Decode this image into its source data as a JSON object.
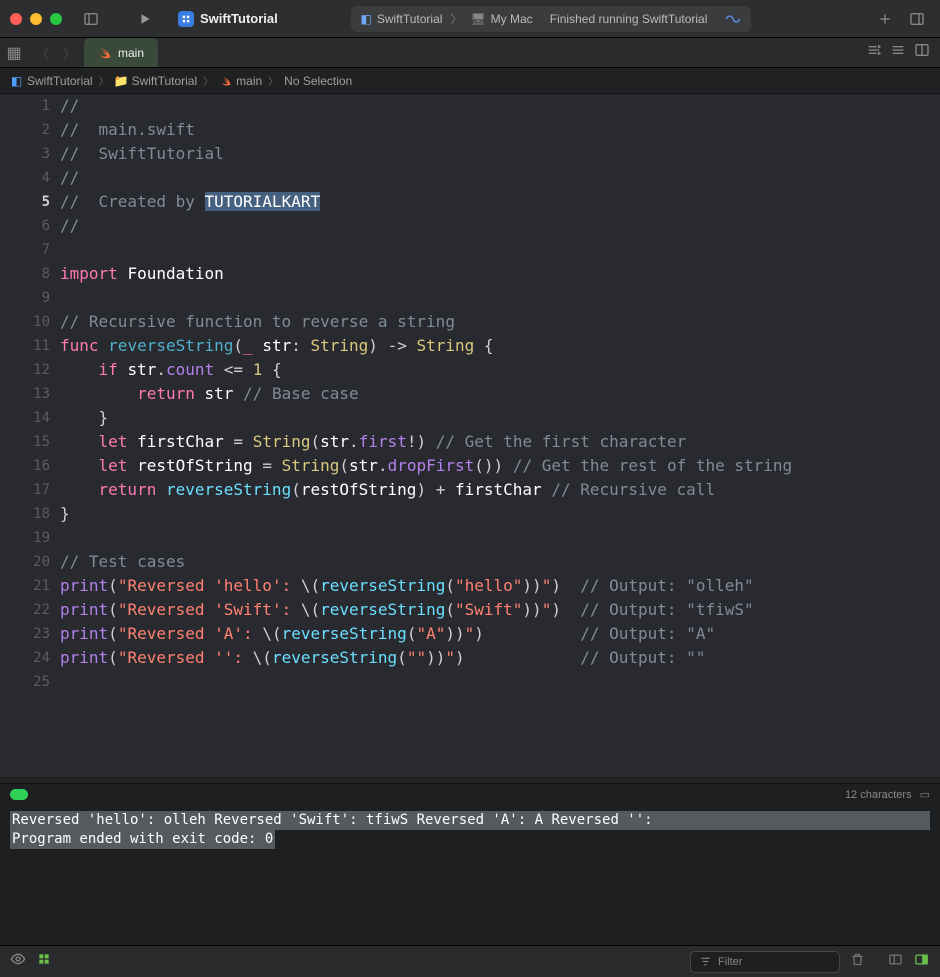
{
  "titlebar": {
    "project_name": "SwiftTutorial",
    "scheme": "SwiftTutorial",
    "destination": "My Mac",
    "status": "Finished running SwiftTutorial"
  },
  "tab": {
    "name": "main"
  },
  "breadcrumb": {
    "items": [
      "SwiftTutorial",
      "SwiftTutorial",
      "main",
      "No Selection"
    ]
  },
  "editor": {
    "current_line": 5,
    "selected_text": "TUTORIALKART",
    "lines": [
      {
        "n": 1,
        "t": "//"
      },
      {
        "n": 2,
        "t": "//  main.swift"
      },
      {
        "n": 3,
        "t": "//  SwiftTutorial"
      },
      {
        "n": 4,
        "t": "//"
      },
      {
        "n": 5,
        "t": "//  Created by TUTORIALKART"
      },
      {
        "n": 6,
        "t": "//"
      },
      {
        "n": 7,
        "t": ""
      },
      {
        "n": 8,
        "t": "import Foundation"
      },
      {
        "n": 9,
        "t": ""
      },
      {
        "n": 10,
        "t": "// Recursive function to reverse a string"
      },
      {
        "n": 11,
        "t": "func reverseString(_ str: String) -> String {"
      },
      {
        "n": 12,
        "t": "    if str.count <= 1 {"
      },
      {
        "n": 13,
        "t": "        return str // Base case"
      },
      {
        "n": 14,
        "t": "    }"
      },
      {
        "n": 15,
        "t": "    let firstChar = String(str.first!) // Get the first character"
      },
      {
        "n": 16,
        "t": "    let restOfString = String(str.dropFirst()) // Get the rest of the string"
      },
      {
        "n": 17,
        "t": "    return reverseString(restOfString) + firstChar // Recursive call"
      },
      {
        "n": 18,
        "t": "}"
      },
      {
        "n": 19,
        "t": ""
      },
      {
        "n": 20,
        "t": "// Test cases"
      },
      {
        "n": 21,
        "t": "print(\"Reversed 'hello': \\(reverseString(\"hello\"))\")  // Output: \"olleh\""
      },
      {
        "n": 22,
        "t": "print(\"Reversed 'Swift': \\(reverseString(\"Swift\"))\")  // Output: \"tfiwS\""
      },
      {
        "n": 23,
        "t": "print(\"Reversed 'A': \\(reverseString(\"A\"))\")          // Output: \"A\""
      },
      {
        "n": 24,
        "t": "print(\"Reversed '': \\(reverseString(\"\"))\")            // Output: \"\""
      },
      {
        "n": 25,
        "t": ""
      }
    ]
  },
  "status_row": {
    "chars": "12 characters"
  },
  "console": {
    "lines": [
      "Reversed 'hello': olleh",
      "Reversed 'Swift': tfiwS",
      "Reversed 'A': A",
      "Reversed '':",
      "Program ended with exit code: 0"
    ]
  },
  "bottom": {
    "filter_placeholder": "Filter"
  }
}
